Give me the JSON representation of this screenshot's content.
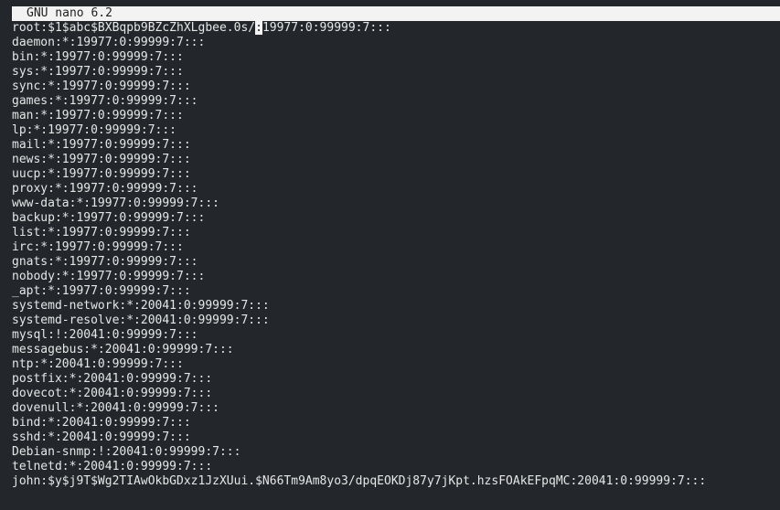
{
  "app": {
    "title": "GNU nano 6.2"
  },
  "editor": {
    "first_line": {
      "before_cursor": "root:$1$abc$BXBqpb9BZcZhXLgbee.0s/",
      "cursor_char": ":",
      "after_cursor": "19977:0:99999:7:::"
    },
    "lines": [
      "daemon:*:19977:0:99999:7:::",
      "bin:*:19977:0:99999:7:::",
      "sys:*:19977:0:99999:7:::",
      "sync:*:19977:0:99999:7:::",
      "games:*:19977:0:99999:7:::",
      "man:*:19977:0:99999:7:::",
      "lp:*:19977:0:99999:7:::",
      "mail:*:19977:0:99999:7:::",
      "news:*:19977:0:99999:7:::",
      "uucp:*:19977:0:99999:7:::",
      "proxy:*:19977:0:99999:7:::",
      "www-data:*:19977:0:99999:7:::",
      "backup:*:19977:0:99999:7:::",
      "list:*:19977:0:99999:7:::",
      "irc:*:19977:0:99999:7:::",
      "gnats:*:19977:0:99999:7:::",
      "nobody:*:19977:0:99999:7:::",
      "_apt:*:19977:0:99999:7:::",
      "systemd-network:*:20041:0:99999:7:::",
      "systemd-resolve:*:20041:0:99999:7:::",
      "mysql:!:20041:0:99999:7:::",
      "messagebus:*:20041:0:99999:7:::",
      "ntp:*:20041:0:99999:7:::",
      "postfix:*:20041:0:99999:7:::",
      "dovecot:*:20041:0:99999:7:::",
      "dovenull:*:20041:0:99999:7:::",
      "bind:*:20041:0:99999:7:::",
      "sshd:*:20041:0:99999:7:::",
      "Debian-snmp:!:20041:0:99999:7:::",
      "telnetd:*:20041:0:99999:7:::",
      "john:$y$j9T$Wg2TIAwOkbGDxz1JzXUui.$N66Tm9Am8yo3/dpqEOKDj87y7jKpt.hzsFOAkEFpqMC:20041:0:99999:7:::"
    ]
  },
  "colors": {
    "background": "#23272b",
    "text": "#e6e6e6",
    "titlebar_bg": "#f3f3f3",
    "titlebar_text": "#1f1f1f"
  }
}
